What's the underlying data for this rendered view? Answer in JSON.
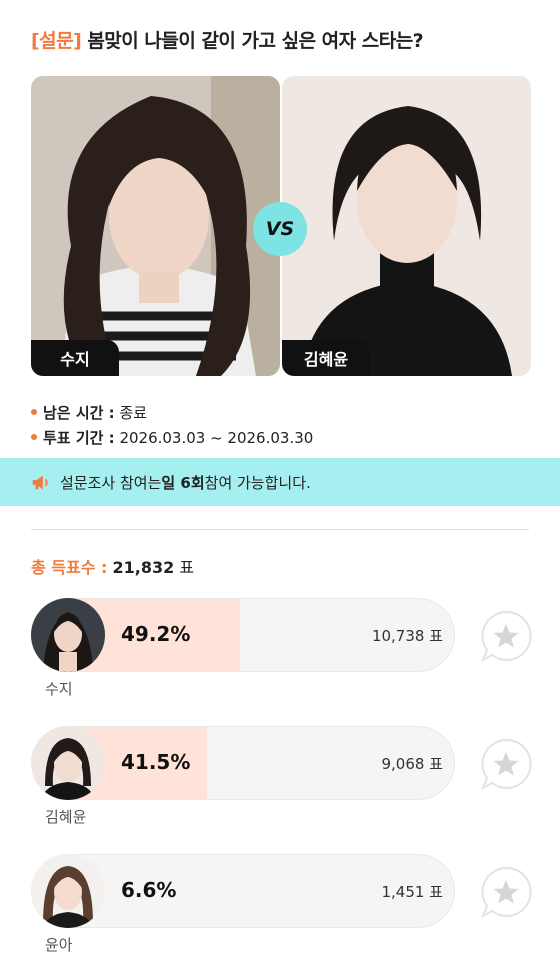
{
  "header": {
    "tag": "[설문]",
    "title": "봄맞이 나들이 같이 가고 싶은 여자 스타는?"
  },
  "matchup": {
    "left_name": "수지",
    "right_name": "김혜윤",
    "vs_label": "VS"
  },
  "info": {
    "remaining_label": "남은 시간 :",
    "remaining_value": "종료",
    "period_label": "투표 기간 :",
    "period_value": "2026.03.03 ~ 2026.03.30"
  },
  "notice": {
    "prefix": "설문조사 참여는 ",
    "emphasis": "일 6회",
    "suffix": " 참여 가능합니다."
  },
  "total": {
    "label": "총 득표수 :",
    "value": "21,832",
    "unit": "표"
  },
  "results": [
    {
      "name": "수지",
      "percent_label": "49.2%",
      "percent": 49.2,
      "votes": "10,738 표"
    },
    {
      "name": "김혜윤",
      "percent_label": "41.5%",
      "percent": 41.5,
      "votes": "9,068 표"
    },
    {
      "name": "윤아",
      "percent_label": "6.6%",
      "percent": 6.6,
      "votes": "1,451 표"
    }
  ],
  "colors": {
    "accent": "#f07b3f",
    "notice_bg": "#a6eff0",
    "vs_badge": "#7de3e3",
    "bar_fill": "#ffe3d8",
    "bar_bg": "#f5f5f5"
  },
  "icons": {
    "notice": "megaphone-icon",
    "favorite": "star-chat-bubble-icon"
  }
}
